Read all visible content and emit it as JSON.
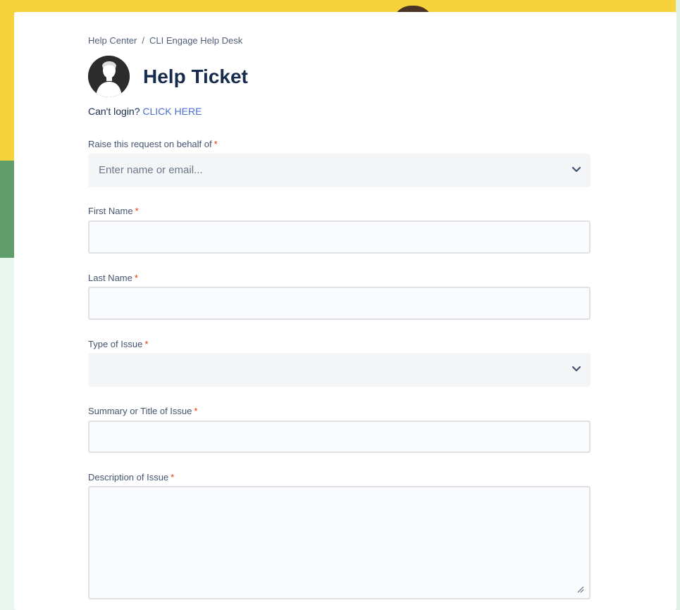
{
  "breadcrumb": {
    "items": [
      "Help Center",
      "CLI Engage Help Desk"
    ],
    "separator": "/"
  },
  "header": {
    "title": "Help Ticket"
  },
  "login": {
    "prompt": "Can't login?",
    "link": "CLICK HERE"
  },
  "required_marker": "*",
  "form": {
    "behalf": {
      "label": "Raise this request on behalf of",
      "placeholder": "Enter name or email..."
    },
    "first_name": {
      "label": "First Name",
      "value": ""
    },
    "last_name": {
      "label": "Last Name",
      "value": ""
    },
    "issue_type": {
      "label": "Type of Issue",
      "value": ""
    },
    "summary": {
      "label": "Summary or Title of Issue",
      "value": ""
    },
    "description": {
      "label": "Description of Issue",
      "value": ""
    }
  },
  "icons": {
    "avatar": "user-silhouette-icon",
    "dropdown": "chevron-down-icon",
    "resize": "resize-handle-icon"
  },
  "colors": {
    "link": "#4a6fd0",
    "required": "#de350b",
    "title": "#172b4d",
    "background_yellow": "#f6d33b",
    "background_green": "#5f9e6b"
  }
}
